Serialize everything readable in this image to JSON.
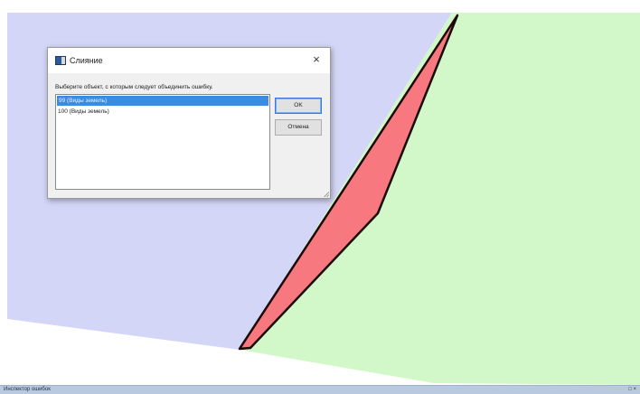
{
  "map": {
    "colors": {
      "left_polygon": "#d3d6f6",
      "right_polygon": "#d2f7c9",
      "error_polygon": "#f7797f",
      "error_outline": "#1a0a0a",
      "background": "#ffffff"
    }
  },
  "dialog": {
    "title": "Слияние",
    "close_icon": "×",
    "prompt": "Выберите объект, с которым следует объединить ошибку.",
    "items": [
      {
        "label": "99 (Виды земель)",
        "selected": true
      },
      {
        "label": "100 (Виды земель)",
        "selected": false
      }
    ],
    "ok_label": "OK",
    "cancel_label": "Отмена"
  },
  "bottom_panel": {
    "title": "Инспектор ошибок",
    "controls": "□ ×"
  }
}
